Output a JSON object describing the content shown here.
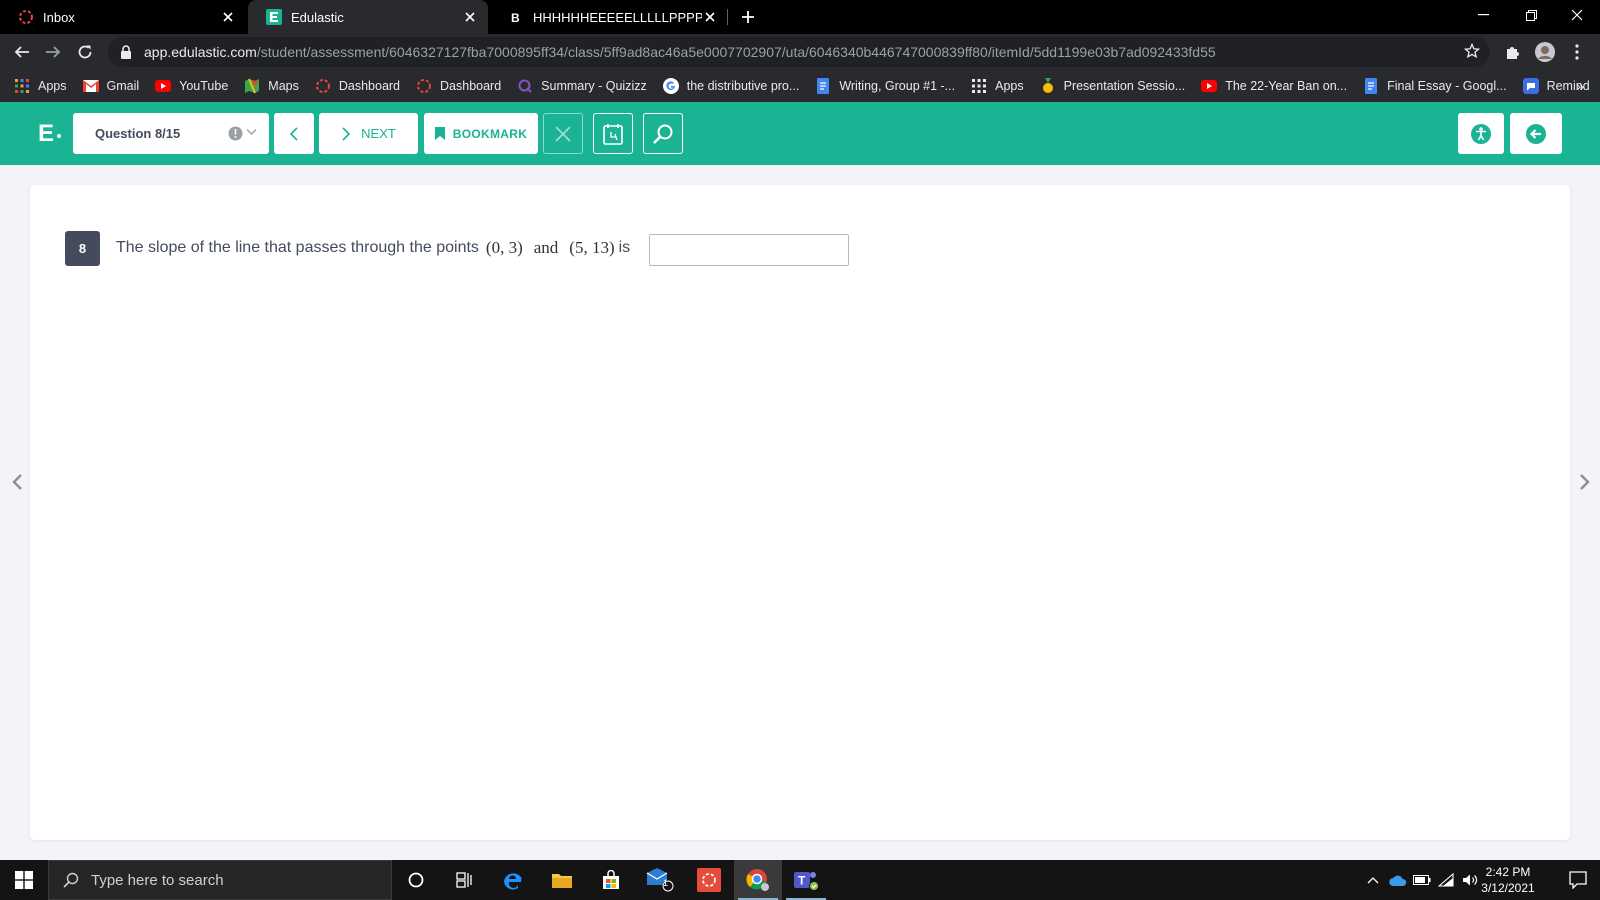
{
  "browser": {
    "tabs": [
      {
        "title": "Inbox",
        "favicon": "loading-ring-icon",
        "active": false
      },
      {
        "title": "Edulastic",
        "favicon": "edulastic-icon",
        "active": true
      },
      {
        "title": "HHHHHHEEEEELLLLLPPPPP - Brain",
        "favicon": "brainly-icon",
        "active": false
      }
    ],
    "url": {
      "host": "app.edulastic.com",
      "path": "/student/assessment/6046327127fba7000895ff34/class/5ff9ad8ac46a5e0007702907/uta/6046340b446747000839ff80/itemId/5dd1199e03b7ad092433fd55"
    },
    "bookmarks": [
      {
        "label": "Apps",
        "icon": "apps-grid-icon"
      },
      {
        "label": "Gmail",
        "icon": "gmail-icon"
      },
      {
        "label": "YouTube",
        "icon": "youtube-icon"
      },
      {
        "label": "Maps",
        "icon": "maps-icon"
      },
      {
        "label": "Dashboard",
        "icon": "loading-ring-icon"
      },
      {
        "label": "Dashboard",
        "icon": "loading-ring-icon"
      },
      {
        "label": "Summary - Quizizz",
        "icon": "quizizz-icon"
      },
      {
        "label": "the distributive pro...",
        "icon": "google-icon"
      },
      {
        "label": "Writing, Group #1 -...",
        "icon": "docs-icon"
      },
      {
        "label": "Apps",
        "icon": "apps-grid-icon"
      },
      {
        "label": "Presentation Sessio...",
        "icon": "medal-icon"
      },
      {
        "label": "The 22-Year Ban on...",
        "icon": "youtube-icon"
      },
      {
        "label": "Final Essay - Googl...",
        "icon": "docs-icon"
      },
      {
        "label": "Remind",
        "icon": "remind-icon"
      }
    ],
    "bookmarks_more": "»"
  },
  "header": {
    "logo": "E",
    "question_selector": "Question 8/15",
    "next_label": "NEXT",
    "bookmark_label": "BOOKMARK"
  },
  "question": {
    "number": "8",
    "text_before": "The slope of the line that passes through the points",
    "point1": "(0, 3)",
    "connector": "and",
    "point2": "(5, 13)",
    "text_after": "is",
    "answer_value": ""
  },
  "taskbar": {
    "search_placeholder": "Type here to search",
    "mail_badge": "1",
    "time": "2:42 PM",
    "date": "3/12/2021"
  },
  "colors": {
    "edulastic_green": "#1ab394",
    "question_badge": "#434b5d"
  }
}
